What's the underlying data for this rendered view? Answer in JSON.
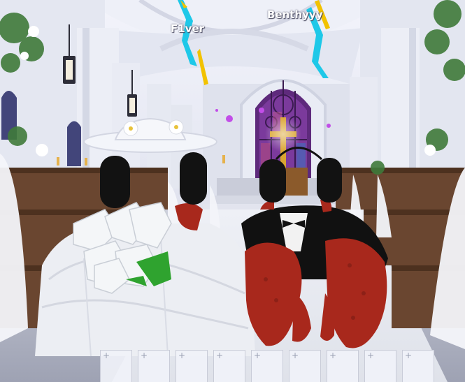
{
  "players": [
    {
      "name": "F1ver"
    },
    {
      "name": "Benthyyy"
    }
  ],
  "hotbar": {
    "slots": [
      {
        "icon": "plus-icon",
        "glyph": "+"
      },
      {
        "icon": "plus-icon",
        "glyph": "+"
      },
      {
        "icon": "plus-icon",
        "glyph": "+"
      },
      {
        "icon": "plus-icon",
        "glyph": "+"
      },
      {
        "icon": "plus-icon",
        "glyph": "+"
      },
      {
        "icon": "plus-icon",
        "glyph": "+"
      },
      {
        "icon": "plus-icon",
        "glyph": "+"
      },
      {
        "icon": "plus-icon",
        "glyph": "+"
      },
      {
        "icon": "plus-icon",
        "glyph": "+"
      }
    ]
  },
  "colors": {
    "crab_red": "#a8281c",
    "window_purple": "#6a2f86",
    "cross_gold": "#d9a431",
    "aura_cyan": "#1ec8e8",
    "aura_yellow": "#f2c200"
  }
}
